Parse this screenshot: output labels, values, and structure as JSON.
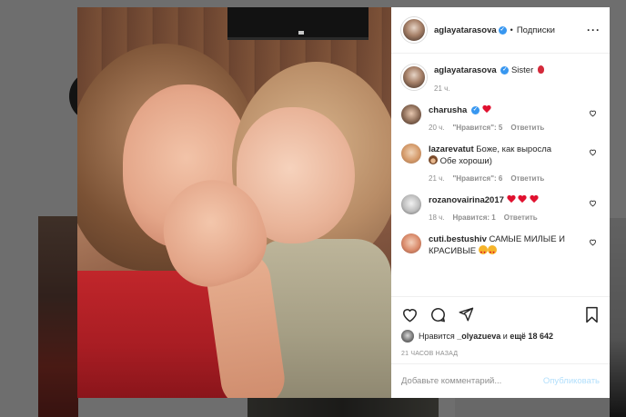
{
  "post": {
    "author": "aglayatarasova",
    "follow_status": "Подписки",
    "dot": "•",
    "more_icon": "more-horizontal-icon"
  },
  "caption": {
    "username": "aglayatarasova",
    "text": "Sister",
    "time": "21 ч."
  },
  "comments": [
    {
      "username": "charusha",
      "text": "",
      "time": "20 ч.",
      "likes": "\"Нравится\": 5",
      "reply": "Ответить"
    },
    {
      "username": "lazarevatut",
      "text": "Боже, как выросла",
      "text2": "Обе хороши)",
      "time": "21 ч.",
      "likes": "\"Нравится\": 6",
      "reply": "Ответить"
    },
    {
      "username": "rozanovairina2017",
      "text": "",
      "time": "18 ч.",
      "likes": "Нравится: 1",
      "reply": "Ответить"
    },
    {
      "username": "cuti.bestushiv",
      "text": "САМЫЕ МИЛЫЕ И КРАСИВЫЕ"
    }
  ],
  "likes_line": {
    "prefix": "Нравится",
    "user": "_olyazueva",
    "connector": "и",
    "count": "ещё 18 642"
  },
  "timestamp": "21 ЧАСОВ НАЗАД",
  "add_comment": {
    "placeholder": "Добавьте комментарий...",
    "publish": "Опубликовать"
  },
  "colors": {
    "accent": "#3897f0",
    "publish_disabled": "#b2dffc",
    "heart": "#e0112f",
    "muted": "#8e8e8e"
  }
}
